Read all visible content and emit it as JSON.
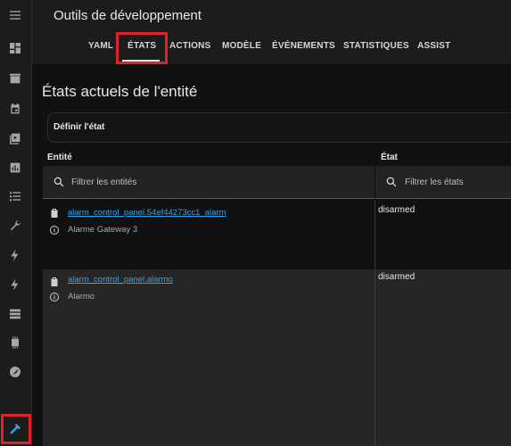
{
  "header": {
    "title": "Outils de développement"
  },
  "tabs": [
    {
      "label": "YAML"
    },
    {
      "label": "ÉTATS"
    },
    {
      "label": "ACTIONS"
    },
    {
      "label": "MODÈLE"
    },
    {
      "label": "ÉVÉNEMENTS"
    },
    {
      "label": "STATISTIQUES"
    },
    {
      "label": "ASSIST"
    }
  ],
  "page": {
    "title": "États actuels de l'entité",
    "set_state_label": "Définir l'état"
  },
  "table": {
    "columns": {
      "entity": "Entité",
      "state": "État"
    },
    "filters": {
      "entity_placeholder": "Filtrer les entités",
      "state_placeholder": "Filtrer les états"
    },
    "rows": [
      {
        "entity_id": "alarm_control_panel.54ef44273cc1_alarm",
        "friendly_name": "Alarme Gateway 3",
        "state": "disarmed"
      },
      {
        "entity_id": "alarm_control_panel.alarmo",
        "friendly_name": "Alarmo",
        "state": "disarmed"
      }
    ]
  },
  "sidebar": {
    "icons": [
      "menu-icon",
      "dashboard-icon",
      "hacs-icon",
      "calendar-icon",
      "media-icon",
      "history-icon",
      "todo-list-icon",
      "wrench-icon",
      "energy-icon",
      "energy-icon-2",
      "server-icon",
      "chip-icon",
      "compass-icon",
      "developer-tools-icon"
    ]
  },
  "colors": {
    "accent": "#e0202a",
    "link": "#3aa3e8",
    "active_icon": "#3aa3e8"
  }
}
